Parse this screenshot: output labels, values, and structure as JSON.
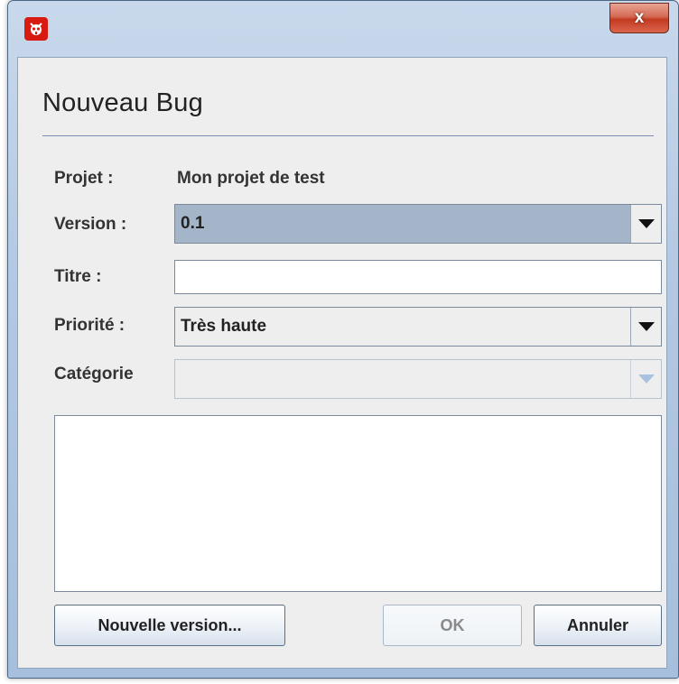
{
  "window": {
    "close_glyph": "x",
    "icon": "bug-app-icon"
  },
  "dialog": {
    "title": "Nouveau Bug"
  },
  "form": {
    "projet_label": "Projet :",
    "projet_value": "Mon projet de test",
    "version_label": "Version :",
    "version_value": "0.1",
    "titre_label": "Titre :",
    "titre_value": "",
    "priorite_label": "Priorité :",
    "priorite_value": "Très haute",
    "categorie_label": "Catégorie",
    "categorie_value": "",
    "description_value": ""
  },
  "buttons": {
    "nouvelle_version": "Nouvelle version...",
    "ok": "OK",
    "annuler": "Annuler"
  },
  "colors": {
    "selected_combo": "#a4b5c9",
    "close_button": "#c33a20",
    "app_icon": "#d81a10"
  }
}
